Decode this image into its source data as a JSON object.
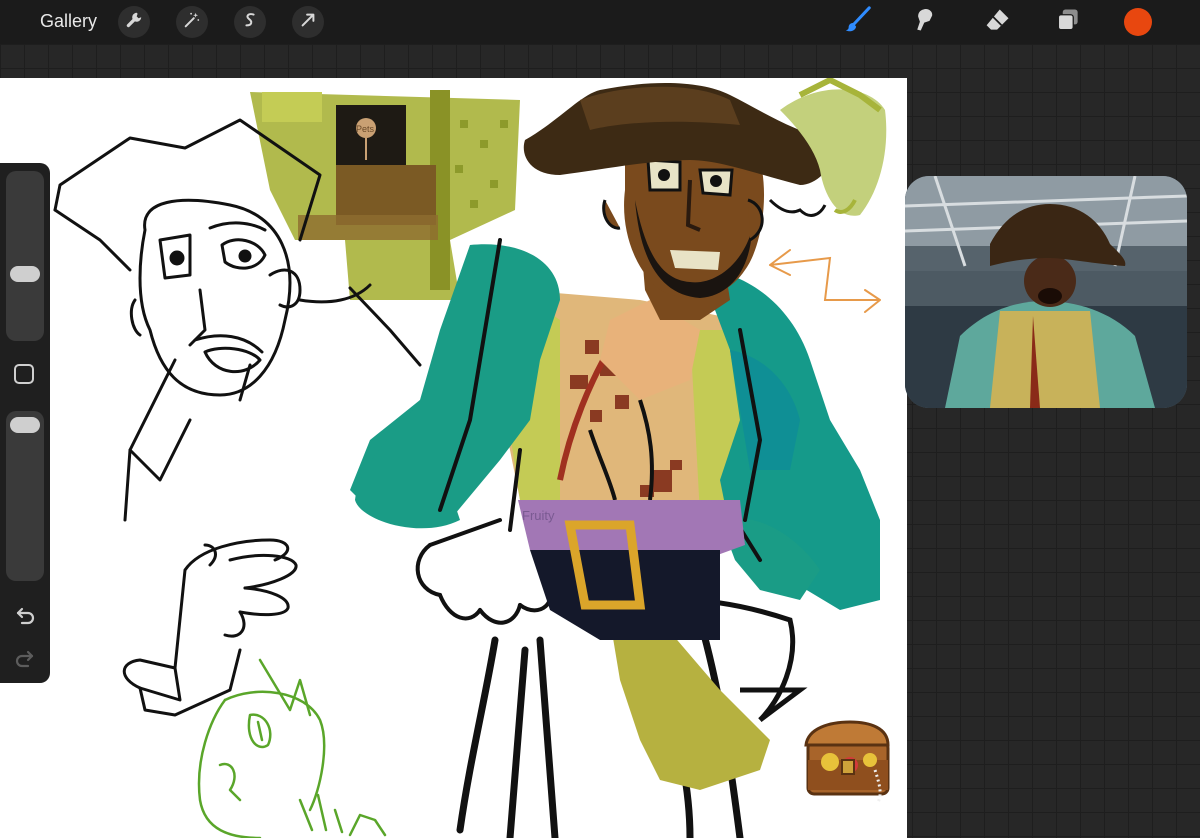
{
  "topbar": {
    "gallery_label": "Gallery",
    "actions": [
      "wrench-icon",
      "magic-wand-icon",
      "selection-s-icon",
      "transform-arrow-icon"
    ],
    "tools": [
      "brush-icon",
      "smudge-icon",
      "eraser-icon",
      "layers-icon"
    ],
    "active_tool": "brush-icon",
    "current_color": "#e8470f"
  },
  "sidebar": {
    "brush_size_level": 0.6,
    "opacity_level": 0.95,
    "controls": [
      "brush-size-slider",
      "modify-square-button",
      "opacity-slider",
      "undo-icon",
      "redo-icon"
    ]
  },
  "canvas": {
    "belt_text": "Fruity",
    "sign_text": "Pets"
  },
  "reference_window": {
    "content": "photo-reference-pirate"
  }
}
